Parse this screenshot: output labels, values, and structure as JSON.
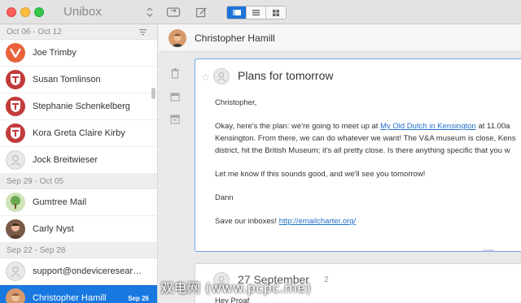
{
  "app": {
    "title": "Unibox"
  },
  "toolbar": {
    "sort_icon": "sort-arrows-icon",
    "refresh_icon": "refresh-icon",
    "compose_icon": "compose-icon",
    "view_modes": [
      "card-view-icon",
      "list-view-icon",
      "grid-view-icon"
    ],
    "active_view": 0
  },
  "sidebar": {
    "groups": [
      {
        "label": "Oct 06 - Oct 12",
        "items": [
          {
            "name": "Joe Trimby",
            "avatar": "v-logo"
          },
          {
            "name": "Susan Tomlinson",
            "avatar": "crest"
          },
          {
            "name": "Stephanie Schenkelberg",
            "avatar": "crest"
          },
          {
            "name": "Kora Greta Claire Kirby",
            "avatar": "crest"
          },
          {
            "name": "Jock Breitwieser",
            "avatar": "blank"
          }
        ]
      },
      {
        "label": "Sep 29 - Oct 05",
        "items": [
          {
            "name": "Gumtree Mail",
            "avatar": "tree"
          },
          {
            "name": "Carly Nyst",
            "avatar": "person"
          }
        ]
      },
      {
        "label": "Sep 22 - Sep 28",
        "items": [
          {
            "name": "support@ondeviceresear…",
            "avatar": "blank"
          },
          {
            "name": "Christopher Hamill",
            "avatar": "person",
            "date": "Sep 26",
            "selected": true
          }
        ]
      }
    ]
  },
  "main": {
    "contact_name": "Christopher Hamill",
    "side_icons": [
      "trash-icon",
      "archive-icon",
      "archive-box-icon"
    ],
    "message": {
      "subject": "Plans for tomorrow",
      "greeting": "Christopher,",
      "p1_before": "Okay, here's the plan: we're going to meet up at ",
      "p1_link": "My Old Dutch in Kensington",
      "p1_after": " at 11.00a",
      "p1_line2": "Kensington. From there, we can do whatever we want! The V&A museum is close, Kens",
      "p1_line3": "district, hit the British Museum; it's all pretty close. Is there anything specific that you w",
      "p2": "Let me know if this sounds good, and we'll see you tomorrow!",
      "signature": "Dann",
      "p3_before": "Save our inboxes! ",
      "p3_link": "http://emailcharter.org/"
    },
    "message2": {
      "subject": "27 September",
      "count": "2",
      "greeting": "Hey Proaf"
    }
  },
  "watermark": "双电网 (www.pcpc.me)",
  "colors": {
    "accent": "#1878e0",
    "link": "#1f6fc9"
  }
}
